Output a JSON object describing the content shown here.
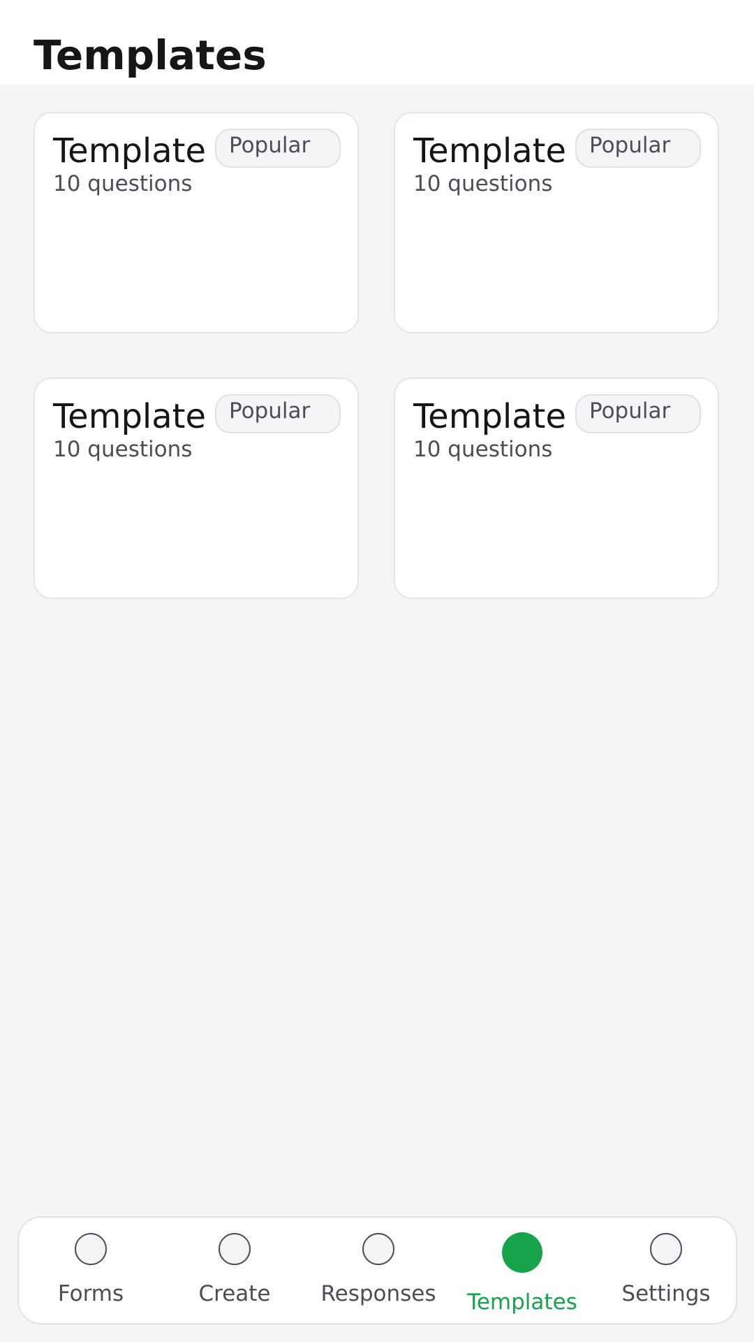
{
  "header": {
    "title": "Templates"
  },
  "templates": [
    {
      "title": "Template",
      "subtitle": "10 questions",
      "badge": "Popular"
    },
    {
      "title": "Template",
      "subtitle": "10 questions",
      "badge": "Popular"
    },
    {
      "title": "Template",
      "subtitle": "10 questions",
      "badge": "Popular"
    },
    {
      "title": "Template",
      "subtitle": "10 questions",
      "badge": "Popular"
    }
  ],
  "bottom_nav": {
    "active": "Templates",
    "items": [
      {
        "label": "Forms",
        "icon": "circle-icon"
      },
      {
        "label": "Create",
        "icon": "circle-icon"
      },
      {
        "label": "Responses",
        "icon": "circle-icon"
      },
      {
        "label": "Templates",
        "icon": "filled-circle-icon"
      },
      {
        "label": "Settings",
        "icon": "circle-icon"
      }
    ]
  },
  "colors": {
    "accent": "#16a34a",
    "background": "#f4f5f7",
    "text_primary": "#161616",
    "text_secondary": "#4c4d56"
  }
}
